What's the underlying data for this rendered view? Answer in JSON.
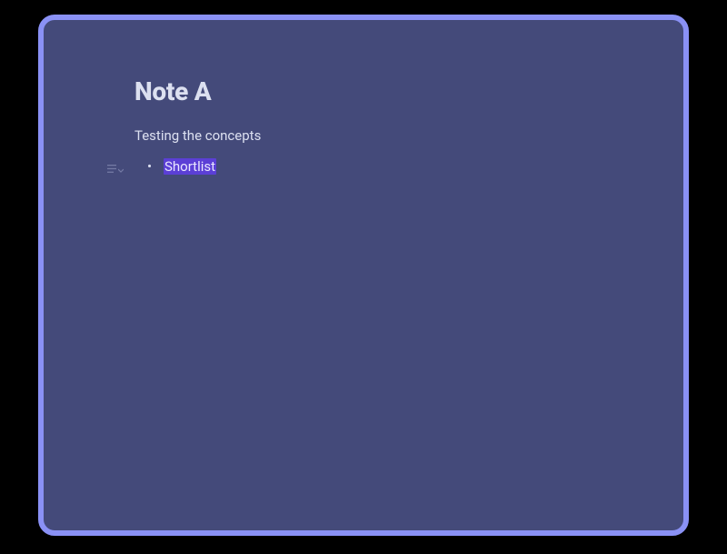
{
  "note": {
    "title": "Note A",
    "paragraph": "Testing the concepts",
    "list": {
      "items": [
        {
          "text": "Shortlist",
          "highlighted": true
        }
      ]
    }
  },
  "colors": {
    "frame_border": "#8a91f5",
    "background": "#444a7a",
    "text": "#dce0f0",
    "highlight_bg": "#5b3fd6"
  }
}
